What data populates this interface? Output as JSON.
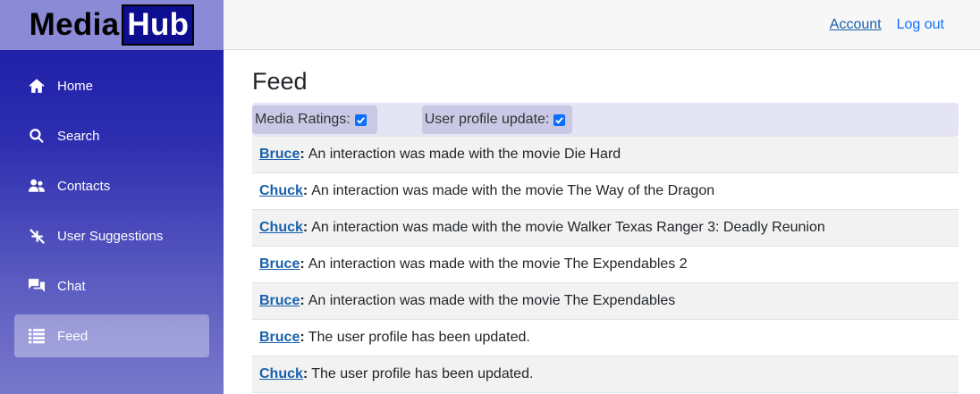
{
  "brand": {
    "part1": "Media",
    "part2": "Hub"
  },
  "sidebar": {
    "items": [
      {
        "label": "Home",
        "icon": "home-icon",
        "active": false
      },
      {
        "label": "Search",
        "icon": "search-icon",
        "active": false
      },
      {
        "label": "Contacts",
        "icon": "contacts-icon",
        "active": false
      },
      {
        "label": "User Suggestions",
        "icon": "suggestions-icon",
        "active": false
      },
      {
        "label": "Chat",
        "icon": "chat-icon",
        "active": false
      },
      {
        "label": "Feed",
        "icon": "list-icon",
        "active": true
      }
    ]
  },
  "topbar": {
    "account_label": "Account",
    "logout_label": "Log out"
  },
  "main": {
    "title": "Feed",
    "filters": [
      {
        "label": "Media Ratings:",
        "checked": true
      },
      {
        "label": "User profile update:",
        "checked": true
      }
    ],
    "feed": [
      {
        "user": "Bruce",
        "text": "An interaction was made with the movie Die Hard"
      },
      {
        "user": "Chuck",
        "text": "An interaction was made with the movie The Way of the Dragon"
      },
      {
        "user": "Chuck",
        "text": "An interaction was made with the movie Walker Texas Ranger 3: Deadly Reunion"
      },
      {
        "user": "Bruce",
        "text": "An interaction was made with the movie The Expendables 2"
      },
      {
        "user": "Bruce",
        "text": "An interaction was made with the movie The Expendables"
      },
      {
        "user": "Bruce",
        "text": "The user profile has been updated."
      },
      {
        "user": "Chuck",
        "text": "The user profile has been updated."
      }
    ]
  },
  "colors": {
    "sidebar_top": "#1a1aa6",
    "sidebar_bottom": "#7878cc",
    "link": "#1861ac",
    "filter_bar": "#e4e4f4",
    "checkbox": "#0d6efd"
  }
}
